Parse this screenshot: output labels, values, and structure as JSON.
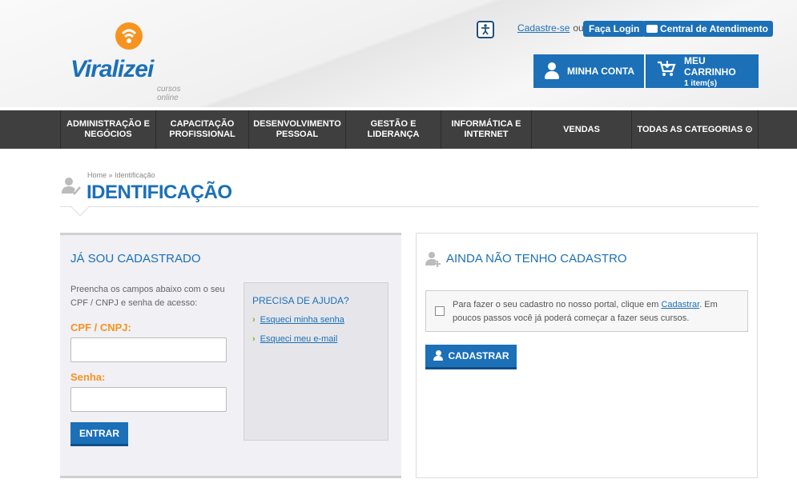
{
  "header": {
    "logo_text": "Viralizei",
    "logo_sub": "cursos online",
    "accessibility_icon": "accessibility-icon",
    "signup_link": "Cadastre-se",
    "or_text": "ou",
    "login_label": "Faça Login",
    "support_label": "Central de Atendimento",
    "account_label": "MINHA CONTA",
    "cart_title": "MEU CARRINHO",
    "cart_count": "1 item(s)"
  },
  "nav": {
    "items": [
      {
        "label": "ADMINISTRAÇÃO E NEGÓCIOS"
      },
      {
        "label": "CAPACITAÇÃO PROFISSIONAL"
      },
      {
        "label": "DESENVOLVIMENTO PESSOAL"
      },
      {
        "label": "GESTÃO E LIDERANÇA"
      },
      {
        "label": "INFORMÁTICA E INTERNET"
      },
      {
        "label": "VENDAS"
      },
      {
        "label": "TODAS AS CATEGORIAS ⊙"
      }
    ]
  },
  "page": {
    "breadcrumb": "Home » Identificação",
    "title": "IDENTIFICAÇÃO"
  },
  "login": {
    "title": "JÁ SOU CADASTRADO",
    "description": "Preencha os campos abaixo com o seu CPF / CNPJ e senha de acesso:",
    "cpf_label": "CPF / CNPJ:",
    "cpf_value": "",
    "password_label": "Senha:",
    "password_value": "",
    "submit_label": "ENTRAR"
  },
  "help": {
    "title": "PRECISA DE AJUDA?",
    "links": [
      "Esqueci minha senha",
      "Esqueci meu e-mail"
    ]
  },
  "register": {
    "title": "AINDA NÃO TENHO CADASTRO",
    "text_before": "Para fazer o seu cadastro no nosso portal, clique em ",
    "link": "Cadastrar",
    "text_after": ". Em poucos passos você já poderá começar a fazer seus cursos.",
    "button_label": "CADASTRAR"
  },
  "colors": {
    "accent_blue": "#1b70b8",
    "accent_orange": "#f7931e",
    "nav_bg": "#3f3f3f"
  }
}
